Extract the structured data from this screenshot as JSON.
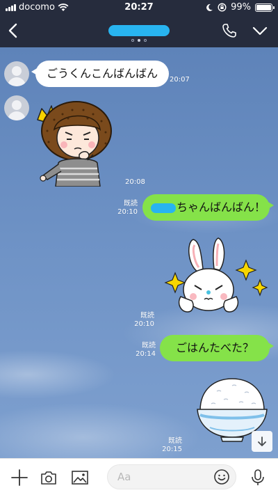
{
  "status": {
    "carrier": "docomo",
    "time": "20:27",
    "battery": "99%",
    "battery_level": 0.99
  },
  "header": {
    "page_dots": 3,
    "active_dot": 1
  },
  "messages": [
    {
      "type": "text",
      "direction": "in",
      "text": "ごうくんこんばんばん",
      "time": "20:07"
    },
    {
      "type": "sticker",
      "direction": "in",
      "sticker": "girl-bob-hair-sticker",
      "time": "20:08"
    },
    {
      "type": "text",
      "direction": "out",
      "text": "ちゃんばんばん！",
      "read": "既読",
      "time": "20:10"
    },
    {
      "type": "sticker",
      "direction": "out",
      "sticker": "rabbit-sparkle-sticker",
      "read": "既読",
      "time": "20:10"
    },
    {
      "type": "text",
      "direction": "out",
      "text": "ごはんたべた？",
      "read": "既読",
      "time": "20:14"
    },
    {
      "type": "sticker",
      "direction": "out",
      "sticker": "rice-bowl-sticker",
      "read": "既読",
      "time": "20:15"
    }
  ],
  "input": {
    "placeholder": "Aa"
  },
  "colors": {
    "header_bg": "#262c3d",
    "chat_bg": "#6f93c6",
    "outgoing_bubble": "#85e249",
    "incoming_bubble": "#ffffff",
    "redaction": "#28b4f0"
  }
}
